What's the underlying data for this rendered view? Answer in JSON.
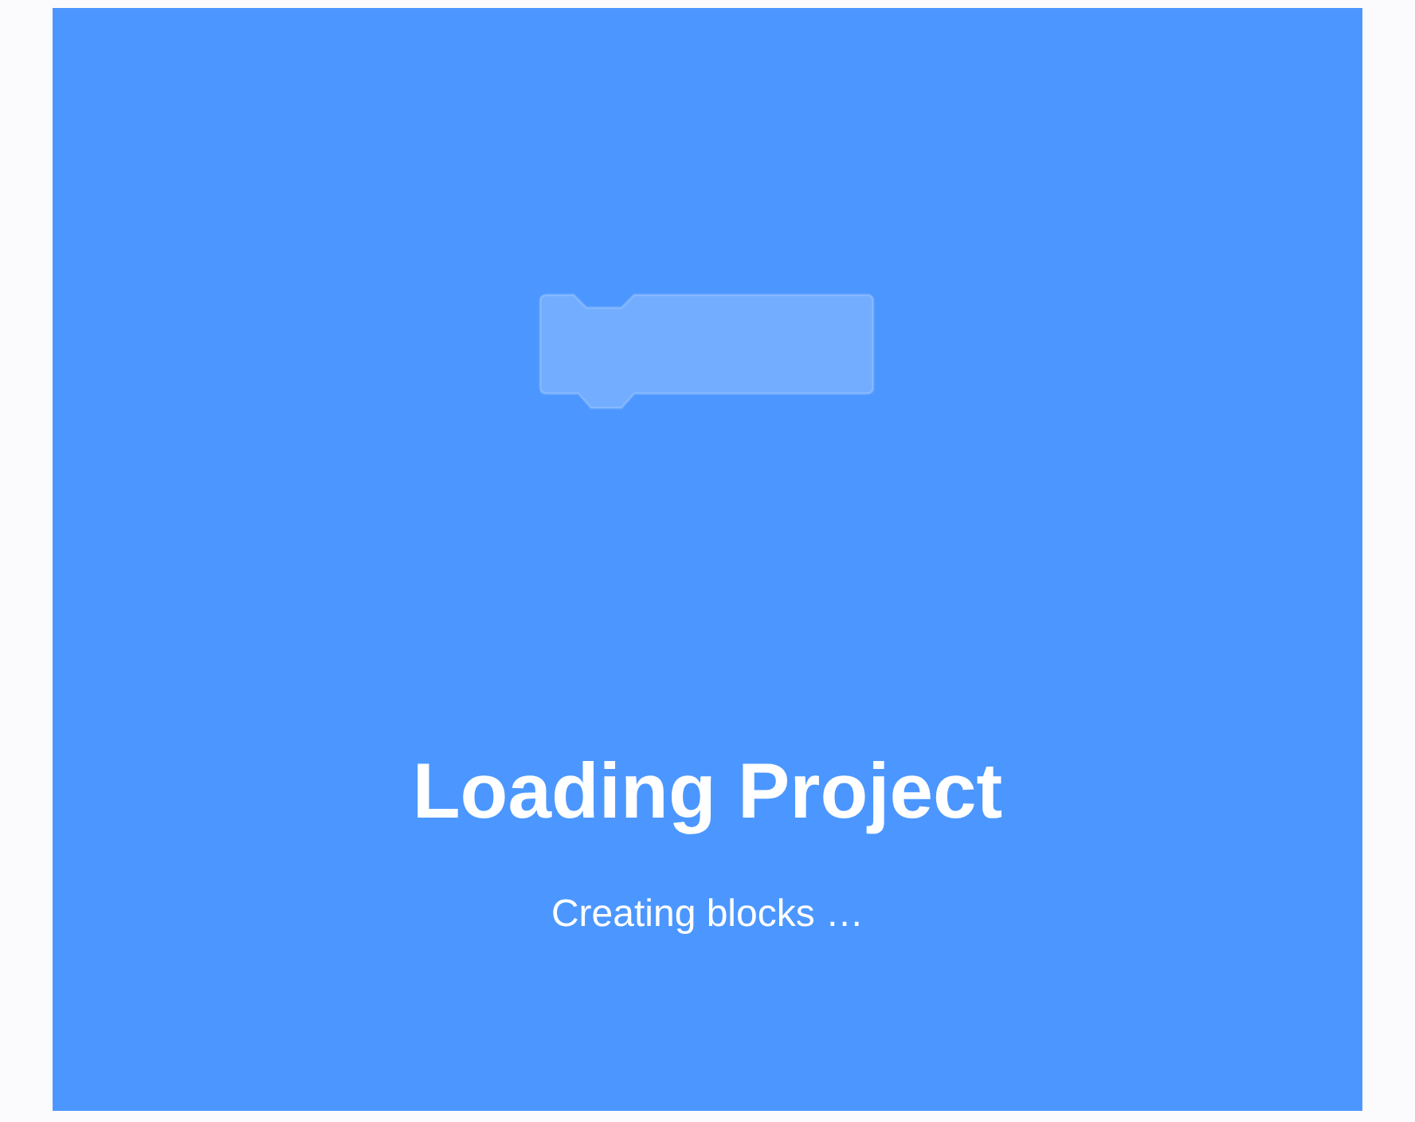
{
  "loader": {
    "title": "Loading Project",
    "message": "Creating blocks …"
  }
}
